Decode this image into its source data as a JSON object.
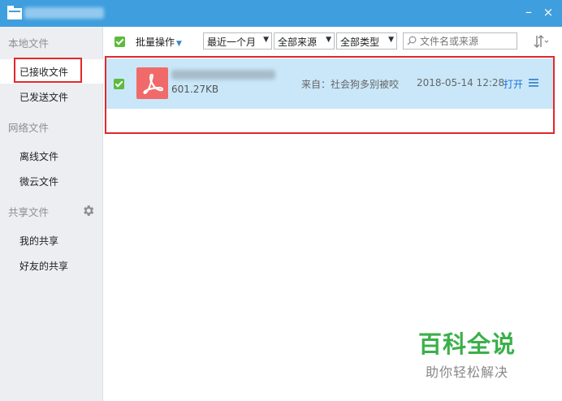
{
  "window": {
    "minimize_glyph": "–",
    "close_glyph": "×"
  },
  "sidebar": {
    "sections": [
      {
        "label": "本地文件",
        "items": [
          "已接收文件",
          "已发送文件"
        ]
      },
      {
        "label": "网络文件",
        "items": [
          "离线文件",
          "微云文件"
        ]
      },
      {
        "label": "共享文件",
        "items": [
          "我的共享",
          "好友的共享"
        ]
      }
    ],
    "active_item": "已接收文件"
  },
  "toolbar": {
    "batch_label": "批量操作",
    "time_filter": "最近一个月",
    "source_filter": "全部来源",
    "type_filter": "全部类型",
    "search_placeholder": "文件名或来源"
  },
  "files": [
    {
      "size": "601.27KB",
      "source": "来自：社会狗多别被咬",
      "date": "2018-05-14 12:28",
      "action": "打开",
      "type": "pdf"
    }
  ],
  "watermark": {
    "title": "百科全说",
    "subtitle": "助你轻松解决"
  },
  "colors": {
    "titlebar": "#3f9ede",
    "selected_row": "#c9e7f9",
    "highlight": "#e2282b",
    "checkbox": "#5dbb3d",
    "pdf": "#f16a6a",
    "link": "#1a73d8",
    "watermark": "#3bb04a"
  }
}
